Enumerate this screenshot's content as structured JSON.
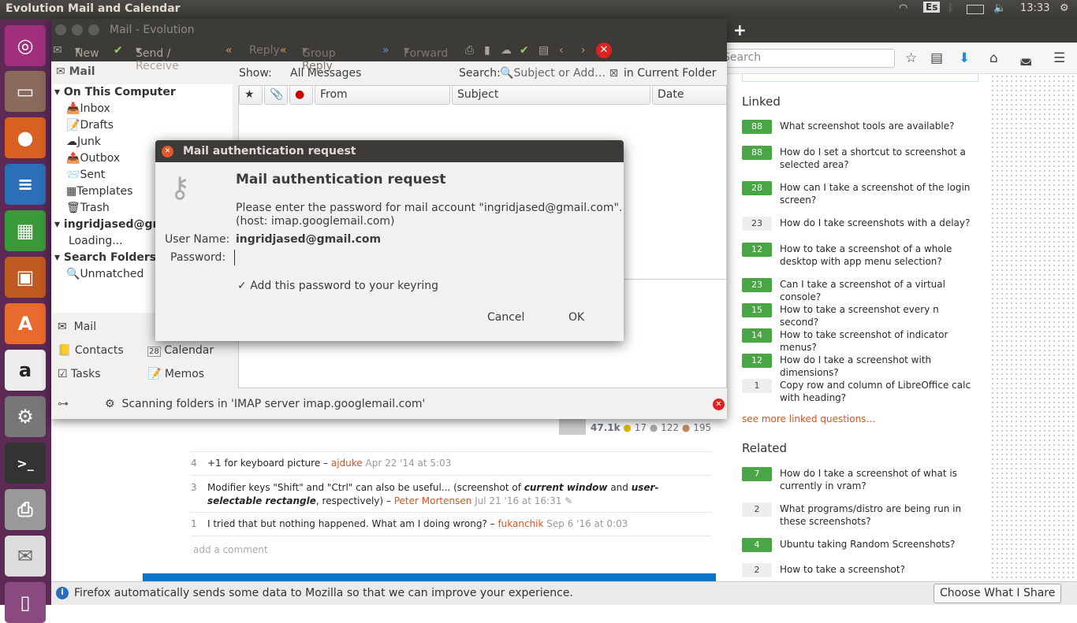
{
  "panel": {
    "title": "Evolution Mail and Calendar",
    "keyboard": "Es",
    "clock": "13:33"
  },
  "firefox": {
    "new_tab": "+",
    "search_placeholder": "Search",
    "linked_heading": "Linked",
    "linked": [
      {
        "score": "88",
        "accepted": true,
        "text": "What screenshot tools are available?"
      },
      {
        "score": "88",
        "accepted": true,
        "text": "How do I set a shortcut to screenshot a selected area?"
      },
      {
        "score": "28",
        "accepted": true,
        "text": "How can I take a screenshot of the login screen?"
      },
      {
        "score": "23",
        "accepted": false,
        "text": "How do I take screenshots with a delay?"
      },
      {
        "score": "12",
        "accepted": true,
        "text": "How to take a screenshot of a whole desktop with app menu selection?"
      },
      {
        "score": "23",
        "accepted": true,
        "text": "Can I take a screenshot of a virtual console?"
      },
      {
        "score": "15",
        "accepted": true,
        "text": "How to take a screenshot every n second?"
      },
      {
        "score": "14",
        "accepted": true,
        "text": "How to take screenshot of indicator menus?"
      },
      {
        "score": "12",
        "accepted": true,
        "text": "How do I take a screenshot with dimensions?"
      },
      {
        "score": "1",
        "accepted": false,
        "text": "Copy row and column of LibreOffice calc with heading?"
      }
    ],
    "see_more": "see more linked questions…",
    "related_heading": "Related",
    "related": [
      {
        "score": "7",
        "accepted": true,
        "text": "How do I take a screenshot of what is currently in vram?"
      },
      {
        "score": "2",
        "accepted": false,
        "text": "What programs/distro are being run in these screenshots?"
      },
      {
        "score": "4",
        "accepted": true,
        "text": "Ubuntu taking Random Screenshots?"
      },
      {
        "score": "2",
        "accepted": false,
        "text": "How to take a screenshot?"
      }
    ],
    "user_rep": "47.1k",
    "gold": "17",
    "silver": "122",
    "bronze": "195",
    "comments": [
      {
        "score": "4",
        "text": "+1 for keyboard picture –",
        "user": "ajduke",
        "date": "Apr 22 '14 at 5:03"
      },
      {
        "score": "3",
        "text_a": "Modifier keys \"Shift\" and \"Ctrl\" can also be useful... (screenshot of ",
        "em1": "current window",
        "text_b": " and ",
        "em2": "user-selectable rectangle",
        "text_c": ", respectively) –",
        "user": "Peter Mortensen",
        "date": "Jul 21 '16 at 16:31"
      },
      {
        "score": "1",
        "text": "I tried that but nothing happened. What am I doing wrong? –",
        "user": "fukanchik",
        "date": "Sep 6 '16 at 0:03"
      }
    ],
    "add_comment": "add a comment",
    "notification": "Firefox automatically sends some data to Mozilla so that we can improve your experience.",
    "choose_button": "Choose What I Share"
  },
  "evolution": {
    "title": "Mail - Evolution",
    "toolbar": {
      "new": "New",
      "send_receive": "Send / Receive",
      "reply": "Reply",
      "group_reply": "Group Reply",
      "forward": "Forward"
    },
    "sidebar_title": "Mail",
    "on_this_computer": "On This Computer",
    "folders": [
      "Inbox",
      "Drafts",
      "Junk",
      "Outbox",
      "Sent",
      "Templates",
      "Trash"
    ],
    "account": "ingridjased@gmail.com",
    "loading": "Loading...",
    "search_folders": "Search Folders",
    "unmatched": "Unmatched",
    "show_label": "Show:",
    "show_value": "All Messages",
    "search_label": "Search:",
    "search_placeholder": "Subject or Add…",
    "scope": "in Current Folder",
    "columns": [
      "From",
      "Subject",
      "Date"
    ],
    "switcher": {
      "mail": "Mail",
      "contacts": "Contacts",
      "calendar": "Calendar",
      "calendar_day": "28",
      "tasks": "Tasks",
      "memos": "Memos"
    },
    "status": "Scanning folders in 'IMAP server imap.googlemail.com'"
  },
  "dialog": {
    "title": "Mail authentication request",
    "heading": "Mail authentication request",
    "message": "Please enter the password for mail account \"ingridjased@gmail.com\".",
    "host": "(host: imap.googlemail.com)",
    "user_label": "User Name:",
    "user_value": "ingridjased@gmail.com",
    "password_label": "Password:",
    "password_value": "",
    "keyring": "Add this password to your keyring",
    "keyring_checked": true,
    "cancel": "Cancel",
    "ok": "OK"
  }
}
